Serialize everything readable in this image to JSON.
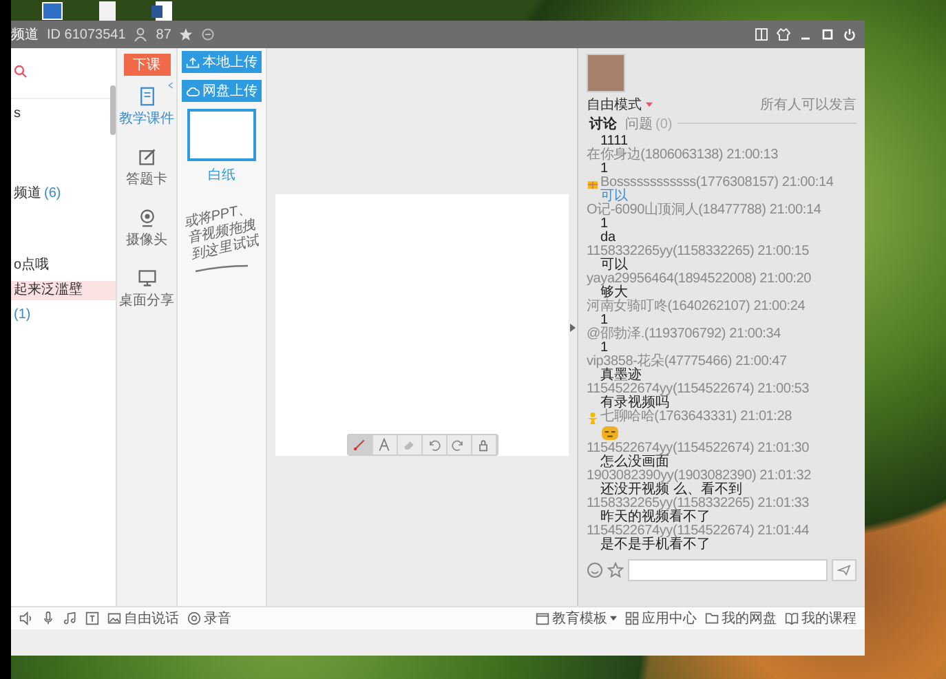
{
  "window": {
    "title": "频道",
    "id": "ID 61073541",
    "members": "87"
  },
  "contacts": {
    "items": [
      {
        "label": "s",
        "selected": false
      },
      {
        "label": "频道",
        "count": "(6)",
        "selected": false
      },
      {
        "label": "o点哦",
        "selected": false
      },
      {
        "label": "起来泛滥壁",
        "selected": true
      },
      {
        "count": "(1)",
        "selected": false
      }
    ]
  },
  "tools": {
    "end_button": "下课",
    "items": [
      {
        "kind": "courseware",
        "label": "教学课件",
        "selected": true
      },
      {
        "kind": "answer",
        "label": "答题卡",
        "selected": false
      },
      {
        "kind": "camera",
        "label": "摄像头",
        "selected": false
      },
      {
        "kind": "screen",
        "label": "桌面分享",
        "selected": false
      }
    ]
  },
  "uploads": {
    "buttons": [
      {
        "kind": "local",
        "label": "本地上传"
      },
      {
        "kind": "cloud",
        "label": "网盘上传"
      }
    ],
    "pages": [
      {
        "label": "白纸",
        "selected": true
      }
    ],
    "hint": [
      "或将PPT、",
      "音视频拖拽",
      "到这里试试"
    ]
  },
  "whiteboard": {
    "tools": [
      {
        "kind": "brush",
        "selected": true
      },
      {
        "kind": "text",
        "selected": false
      },
      {
        "kind": "eraser",
        "selected": false
      },
      {
        "kind": "undo",
        "selected": false
      },
      {
        "kind": "redo",
        "selected": false
      },
      {
        "kind": "lock",
        "selected": false
      }
    ]
  },
  "chat": {
    "mode": "自由模式",
    "permission": "所有人可以发言",
    "tabs": [
      {
        "label": "讨论",
        "selected": true
      },
      {
        "label": "问题",
        "count": "(0)",
        "selected": false
      }
    ],
    "lines": [
      {
        "kind": "message",
        "text": "1111",
        "highlight": false
      },
      {
        "kind": "header",
        "text": "在你身边(1806063138) 21:00:13",
        "gift_badge": false,
        "member_badge": false
      },
      {
        "kind": "message",
        "text": "1",
        "highlight": false
      },
      {
        "kind": "header",
        "text": "Bossssssssssss(1776308157) 21:00:14",
        "gift_badge": true,
        "member_badge": false
      },
      {
        "kind": "message",
        "text": "可以",
        "highlight": true
      },
      {
        "kind": "header",
        "text": "O记-6090山顶洞人(18477788) 21:00:14"
      },
      {
        "kind": "message",
        "text": "1",
        "highlight": false
      },
      {
        "kind": "message",
        "text": "da",
        "highlight": false
      },
      {
        "kind": "header",
        "text": "1158332265yy(1158332265) 21:00:15"
      },
      {
        "kind": "message",
        "text": "可以",
        "highlight": false
      },
      {
        "kind": "header",
        "text": "yaya29956464(1894522008) 21:00:20"
      },
      {
        "kind": "message",
        "text": "够大",
        "highlight": false
      },
      {
        "kind": "header",
        "text": "河南女骑叮咚(1640262107) 21:00:24"
      },
      {
        "kind": "message",
        "text": "1",
        "highlight": false
      },
      {
        "kind": "header",
        "text": "@邵勃泽.(1193706792) 21:00:34"
      },
      {
        "kind": "message",
        "text": "1",
        "highlight": false
      },
      {
        "kind": "header",
        "text": "vip3858-花朵(47775466) 21:00:47"
      },
      {
        "kind": "message",
        "text": "真墨迹",
        "highlight": false
      },
      {
        "kind": "header",
        "text": "1154522674yy(1154522674) 21:00:53"
      },
      {
        "kind": "message",
        "text": "有录视频吗",
        "highlight": false
      },
      {
        "kind": "header",
        "text": "七聊哈哈(1763643331) 21:01:28",
        "gift_badge": false,
        "member_badge": true
      },
      {
        "kind": "emoji"
      },
      {
        "kind": "header",
        "text": "1154522674yy(1154522674) 21:01:30"
      },
      {
        "kind": "message",
        "text": "怎么没画面",
        "highlight": false
      },
      {
        "kind": "header",
        "text": "1903082390yy(1903082390) 21:01:32"
      },
      {
        "kind": "message",
        "text": "还没开视频 么、看不到",
        "highlight": false
      },
      {
        "kind": "header",
        "text": "1158332265yy(1158332265) 21:01:33"
      },
      {
        "kind": "message",
        "text": "昨天的视频看不了",
        "highlight": false
      },
      {
        "kind": "header",
        "text": "1154522674yy(1154522674) 21:01:44"
      },
      {
        "kind": "message",
        "text": "是不是手机看不了",
        "highlight": false
      }
    ]
  },
  "bottom_bar": {
    "left": [
      {
        "kind": "speaker"
      },
      {
        "kind": "mic"
      },
      {
        "kind": "music"
      },
      {
        "kind": "caption"
      },
      {
        "kind": "image",
        "label": "自由说话"
      },
      {
        "kind": "record",
        "label": "录音"
      }
    ],
    "right": [
      {
        "kind": "template",
        "label": "教育模板",
        "dropdown": true
      },
      {
        "kind": "apps",
        "label": "应用中心",
        "dropdown": false
      },
      {
        "kind": "folder",
        "label": "我的网盘",
        "dropdown": false
      },
      {
        "kind": "book",
        "label": "我的课程",
        "dropdown": false
      }
    ]
  }
}
